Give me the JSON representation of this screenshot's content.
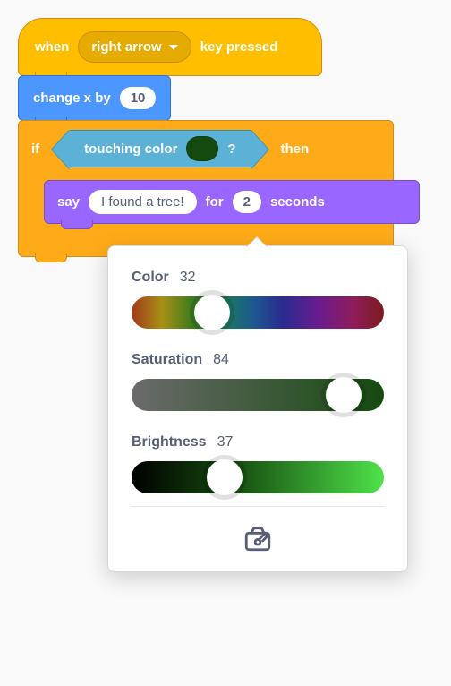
{
  "blocks": {
    "when_key": {
      "prefix": "when",
      "key": "right arrow",
      "suffix": "key pressed"
    },
    "change_x": {
      "label": "change x by",
      "value": "10"
    },
    "if_block": {
      "if_label": "if",
      "then_label": "then",
      "condition": {
        "prefix": "touching color",
        "suffix": "?",
        "color": "#154a0f"
      }
    },
    "say_block": {
      "label": "say",
      "text": "I found a tree!",
      "for_label": "for",
      "seconds_value": "2",
      "seconds_label": "seconds"
    }
  },
  "color_picker": {
    "color": {
      "label": "Color",
      "value": "32",
      "thumb_pct": 32
    },
    "saturation": {
      "label": "Saturation",
      "value": "84",
      "thumb_pct": 84
    },
    "brightness": {
      "label": "Brightness",
      "value": "37",
      "thumb_pct": 37
    }
  }
}
